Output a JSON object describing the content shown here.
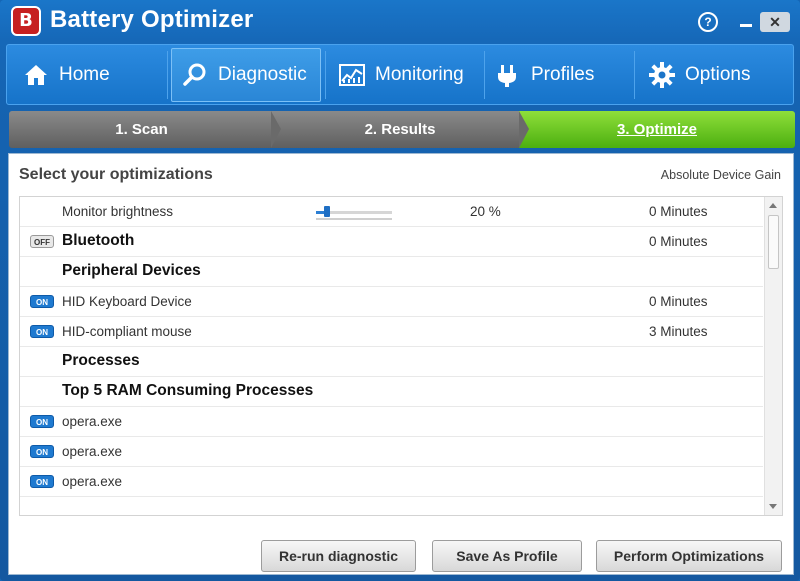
{
  "app": {
    "title": "Battery Optimizer",
    "logo_letter": "B"
  },
  "window_controls": {
    "help": "?",
    "close": "✕"
  },
  "nav": {
    "items": [
      {
        "label": "Home",
        "icon": "home-icon",
        "active": false
      },
      {
        "label": "Diagnostic",
        "icon": "search-icon",
        "active": true
      },
      {
        "label": "Monitoring",
        "icon": "monitoring-chart-icon",
        "active": false
      },
      {
        "label": "Profiles",
        "icon": "plug-icon",
        "active": false
      },
      {
        "label": "Options",
        "icon": "gear-icon",
        "active": false
      }
    ]
  },
  "steps": [
    {
      "label": "1. Scan",
      "state": "done"
    },
    {
      "label": "2. Results",
      "state": "done"
    },
    {
      "label": "3. Optimize",
      "state": "current"
    }
  ],
  "panel": {
    "title": "Select your optimizations",
    "gain_header": "Absolute Device Gain",
    "rows": [
      {
        "label": "Monitor brightness",
        "toggle": null,
        "value": "20 %",
        "gain": "0 Minutes",
        "bold": false,
        "slider_level": 0.15
      },
      {
        "label": "Bluetooth",
        "toggle": "OFF",
        "value": "",
        "gain": "0 Minutes",
        "bold": true
      },
      {
        "label": "Peripheral Devices",
        "toggle": null,
        "value": "",
        "gain": "",
        "bold": true
      },
      {
        "label": "HID Keyboard Device",
        "toggle": "ON",
        "value": "",
        "gain": "0 Minutes",
        "bold": false
      },
      {
        "label": "HID-compliant mouse",
        "toggle": "ON",
        "value": "",
        "gain": "3 Minutes",
        "bold": false
      },
      {
        "label": "Processes",
        "toggle": null,
        "value": "",
        "gain": "",
        "bold": true
      },
      {
        "label": "Top 5 RAM Consuming Processes",
        "toggle": null,
        "value": "",
        "gain": "",
        "bold": true
      },
      {
        "label": "opera.exe",
        "toggle": "ON",
        "value": "",
        "gain": "",
        "bold": false
      },
      {
        "label": "opera.exe",
        "toggle": "ON",
        "value": "",
        "gain": "",
        "bold": false
      },
      {
        "label": "opera.exe",
        "toggle": "ON",
        "value": "",
        "gain": "",
        "bold": false
      }
    ]
  },
  "buttons": {
    "rerun": "Re-run diagnostic",
    "save_profile": "Save As Profile",
    "perform": "Perform Optimizations"
  },
  "colors": {
    "accent_blue": "#1673c9",
    "step_active_green": "#4caf10",
    "step_inactive_gray": "#6f6f6f"
  }
}
